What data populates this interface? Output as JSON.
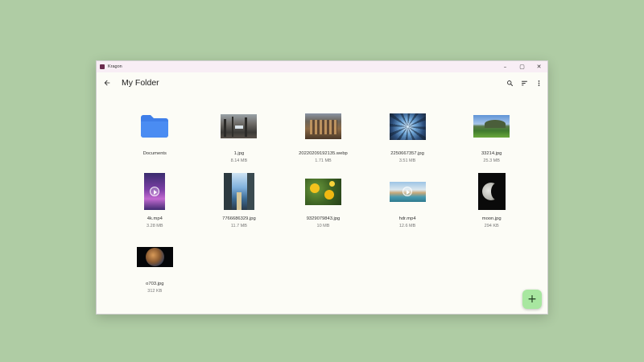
{
  "window": {
    "app_title": "Kragon",
    "controls": {
      "minimize": "–",
      "maximize": "▢",
      "close": "✕"
    }
  },
  "appbar": {
    "title": "My Folder",
    "back_icon": "arrow-left-icon",
    "actions": [
      "search-icon",
      "sort-icon",
      "more-vertical-icon"
    ]
  },
  "items": [
    {
      "name": "Documents",
      "size": "",
      "kind": "folder"
    },
    {
      "name": "1.jpg",
      "size": "8.14 MB",
      "kind": "image"
    },
    {
      "name": "20220209192135.webp",
      "size": "1.71 MB",
      "kind": "image"
    },
    {
      "name": "2250667357.jpg",
      "size": "3.51 MB",
      "kind": "image"
    },
    {
      "name": "33214.jpg",
      "size": "25.3 MB",
      "kind": "image"
    },
    {
      "name": "4k.mp4",
      "size": "3.28 MB",
      "kind": "video"
    },
    {
      "name": "7766686329.jpg",
      "size": "11.7 MB",
      "kind": "image"
    },
    {
      "name": "9329079843.jpg",
      "size": "10 MB",
      "kind": "image"
    },
    {
      "name": "hdr.mp4",
      "size": "12.6 MB",
      "kind": "video"
    },
    {
      "name": "moon.jpg",
      "size": "294 KB",
      "kind": "image"
    },
    {
      "name": "o703.jpg",
      "size": "312 KB",
      "kind": "image"
    }
  ],
  "fab": {
    "label": "+"
  },
  "colors": {
    "background": "#afcca4",
    "window": "#fcfcf6",
    "folder": "#4a8cf2",
    "fab": "#a8e7a0"
  }
}
